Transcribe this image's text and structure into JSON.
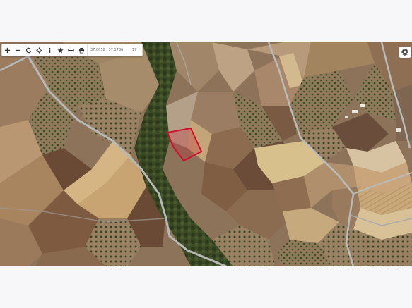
{
  "toolbar": {
    "coords": "37.0058 : 37.1736",
    "zoom": "17",
    "buttons": [
      {
        "name": "zoom-in-button",
        "icon": "plus-icon"
      },
      {
        "name": "zoom-out-button",
        "icon": "minus-icon"
      },
      {
        "name": "refresh-button",
        "icon": "refresh-icon"
      },
      {
        "name": "locate-button",
        "icon": "crosshair-icon"
      },
      {
        "name": "info-button",
        "icon": "info-icon"
      },
      {
        "name": "favorite-button",
        "icon": "star-icon"
      },
      {
        "name": "measure-button",
        "icon": "ruler-icon"
      },
      {
        "name": "print-button",
        "icon": "printer-icon"
      }
    ]
  },
  "settings": {
    "icon": "gear-icon"
  },
  "map": {
    "type": "satellite",
    "parcel_highlight_color": "#d0102a"
  }
}
